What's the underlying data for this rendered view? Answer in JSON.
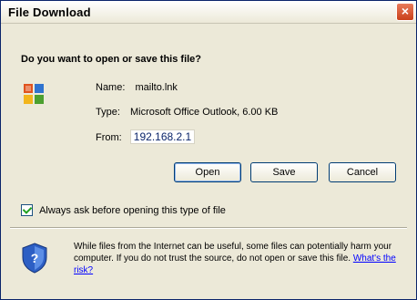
{
  "window": {
    "title": "File Download",
    "close_glyph": "×"
  },
  "question": "Do you want to open or save this file?",
  "file": {
    "name_label": "Name:",
    "name_value": "mailto.lnk",
    "type_label": "Type:",
    "type_value": "Microsoft Office Outlook, 6.00 KB",
    "from_label": "From:",
    "from_value": "192.168.2.1",
    "icon": "office-icon"
  },
  "buttons": {
    "open": "Open",
    "save": "Save",
    "cancel": "Cancel"
  },
  "checkbox": {
    "label": "Always ask before opening this type of file",
    "checked": true
  },
  "warning": {
    "text": "While files from the Internet can be useful, some files can potentially harm your computer. If you do not trust the source, do not open or save this file.",
    "link": "What's the risk?",
    "icon": "shield-icon"
  },
  "colors": {
    "title_text": "#000000",
    "close_button": "#c9401a",
    "dialog_bg": "#ece9d8",
    "link": "#0000ff"
  }
}
